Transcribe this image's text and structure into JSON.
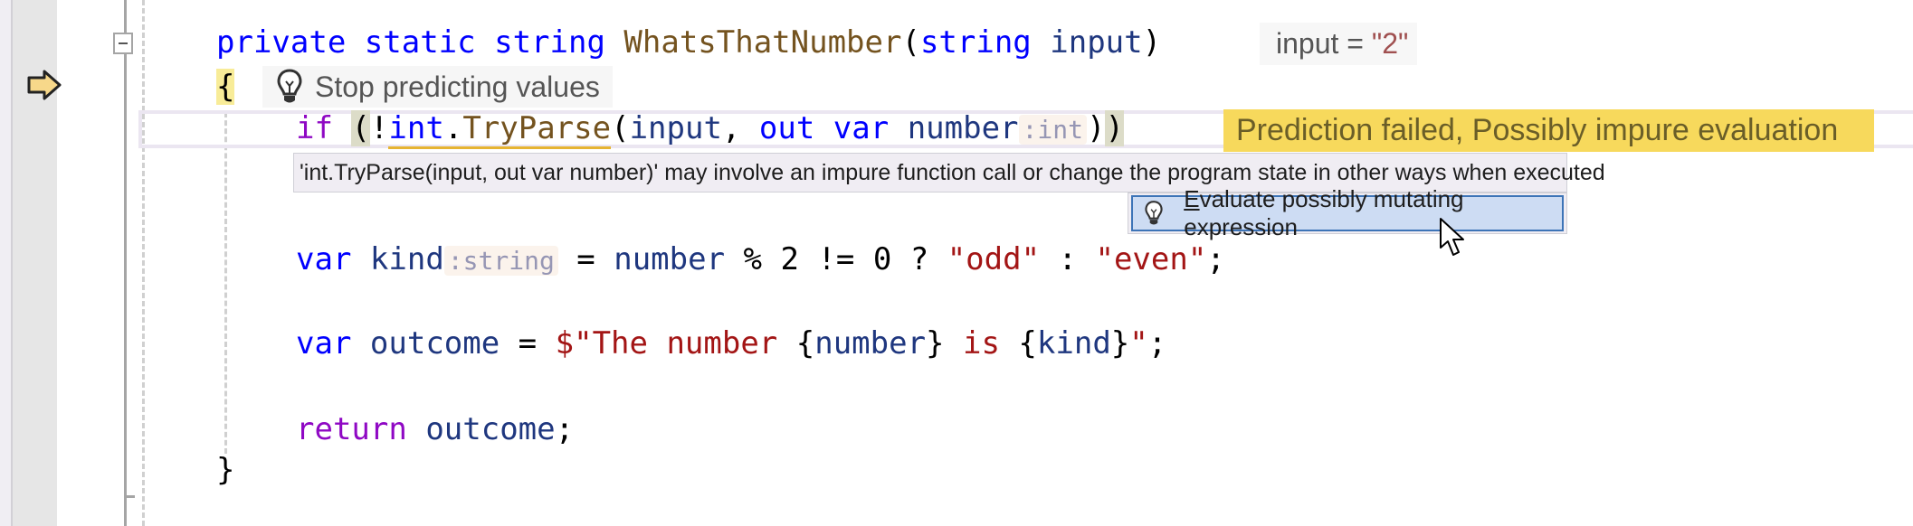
{
  "editor": {
    "lines": {
      "signature": {
        "t1": "private",
        "t2": "static",
        "t3": "string",
        "t4": "WhatsThatNumber",
        "t5": "(",
        "t6": "string",
        "t7": "input",
        "t8": ")"
      },
      "open_brace": "{",
      "if_line": {
        "t1": "if",
        "t2": "(",
        "t3": "!",
        "t4": "int",
        "t5": ".",
        "t6": "TryParse",
        "t7": "(",
        "t8": "input",
        "t9": ", ",
        "t10": "out",
        "t11": "var",
        "t12": "number",
        "hint": ":int",
        "t13": ")",
        "t14": ")"
      },
      "kind_line": {
        "t1": "var",
        "t2": "kind",
        "hint": ":string",
        "t3": " = ",
        "t4": "number",
        "t5": " % 2 != 0 ? ",
        "t6": "\"odd\"",
        "t7": " : ",
        "t8": "\"even\"",
        "t9": ";"
      },
      "outcome_line": {
        "t1": "var",
        "t2": "outcome",
        "t3": " = ",
        "t4": "$\"The number ",
        "t5": "{",
        "t6": "number",
        "t7": "}",
        "t8": " is ",
        "t9": "{",
        "t10": "kind",
        "t11": "}",
        "t12": "\"",
        "t13": ";"
      },
      "return_line": {
        "t1": "return",
        "t2": "outcome",
        "t3": ";"
      },
      "close_brace": "}"
    }
  },
  "inline_values": {
    "param_name": "input",
    "equals": " = ",
    "param_value": "\"2\"",
    "stop_predicting_label": "Stop predicting values",
    "prediction_status": "Prediction failed,   Possibly impure evaluation"
  },
  "tooltip": {
    "message": "'int.TryParse(input, out var number)' may involve an impure function call or change the program state in other ways when executed"
  },
  "action": {
    "mnemonic": "E",
    "label_rest": "valuate possibly mutating expression"
  },
  "icons": {
    "instruction_pointer": "yellow-arrow",
    "lightbulb": "lightbulb",
    "collapse": "minus-box",
    "cursor": "mouse-pointer"
  },
  "colors": {
    "keyword": "#0000ff",
    "control_keyword": "#8f08c4",
    "method": "#74531f",
    "identifier": "#1f377f",
    "string": "#a31515",
    "prediction_banner": "#f7d95c",
    "action_highlight": "#cddcf3",
    "action_border": "#3d74b7"
  }
}
